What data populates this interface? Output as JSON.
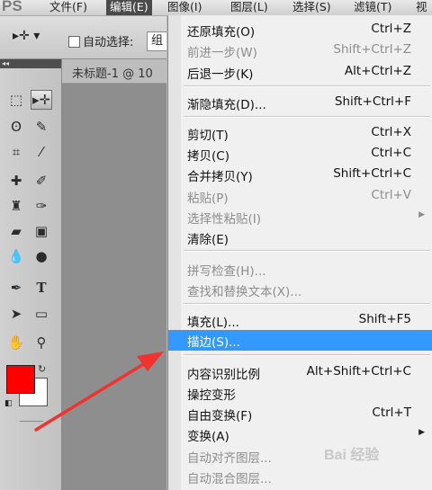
{
  "app": {
    "logo": "PS"
  },
  "menubar": [
    {
      "label": "文件(F)",
      "active": false
    },
    {
      "label": "编辑(E)",
      "active": true
    },
    {
      "label": "图像(I)",
      "active": false
    },
    {
      "label": "图层(L)",
      "active": false
    },
    {
      "label": "选择(S)",
      "active": false
    },
    {
      "label": "滤镜(T)",
      "active": false
    },
    {
      "label": "视",
      "active": false
    }
  ],
  "options": {
    "tool_icon": "move-tool-icon",
    "auto_select_label": "自动选择:",
    "auto_select_checked": false,
    "group_select_value": "组"
  },
  "toolbox": {
    "header": "◂◂"
  },
  "document": {
    "tab_title": "未标题-1 @ 10"
  },
  "colors": {
    "foreground": "#ff0000",
    "background": "#ffffff",
    "highlight": "#3399ff"
  },
  "edit_menu": {
    "items": [
      {
        "label": "还原填充(O)",
        "shortcut": "Ctrl+Z",
        "disabled": false
      },
      {
        "label": "前进一步(W)",
        "shortcut": "Shift+Ctrl+Z",
        "disabled": true
      },
      {
        "label": "后退一步(K)",
        "shortcut": "Alt+Ctrl+Z",
        "disabled": false
      },
      {
        "label": "渐隐填充(D)...",
        "shortcut": "Shift+Ctrl+F",
        "disabled": false
      },
      {
        "label": "剪切(T)",
        "shortcut": "Ctrl+X",
        "disabled": false
      },
      {
        "label": "拷贝(C)",
        "shortcut": "Ctrl+C",
        "disabled": false
      },
      {
        "label": "合并拷贝(Y)",
        "shortcut": "Shift+Ctrl+C",
        "disabled": false
      },
      {
        "label": "粘贴(P)",
        "shortcut": "Ctrl+V",
        "disabled": true
      },
      {
        "label": "选择性粘贴(I)",
        "shortcut": "",
        "disabled": true,
        "submenu": true
      },
      {
        "label": "清除(E)",
        "shortcut": "",
        "disabled": false
      },
      {
        "label": "拼写检查(H)...",
        "shortcut": "",
        "disabled": true
      },
      {
        "label": "查找和替换文本(X)...",
        "shortcut": "",
        "disabled": true
      },
      {
        "label": "填充(L)...",
        "shortcut": "Shift+F5",
        "disabled": false
      },
      {
        "label": "描边(S)...",
        "shortcut": "",
        "disabled": false,
        "highlighted": true
      },
      {
        "label": "内容识别比例",
        "shortcut": "Alt+Shift+Ctrl+C",
        "disabled": false
      },
      {
        "label": "操控变形",
        "shortcut": "",
        "disabled": false
      },
      {
        "label": "自由变换(F)",
        "shortcut": "Ctrl+T",
        "disabled": false
      },
      {
        "label": "变换(A)",
        "shortcut": "",
        "disabled": false,
        "submenu": true
      },
      {
        "label": "自动对齐图层...",
        "shortcut": "",
        "disabled": true
      },
      {
        "label": "自动混合图层...",
        "shortcut": "",
        "disabled": true
      }
    ]
  },
  "watermark": "Bai 经验"
}
